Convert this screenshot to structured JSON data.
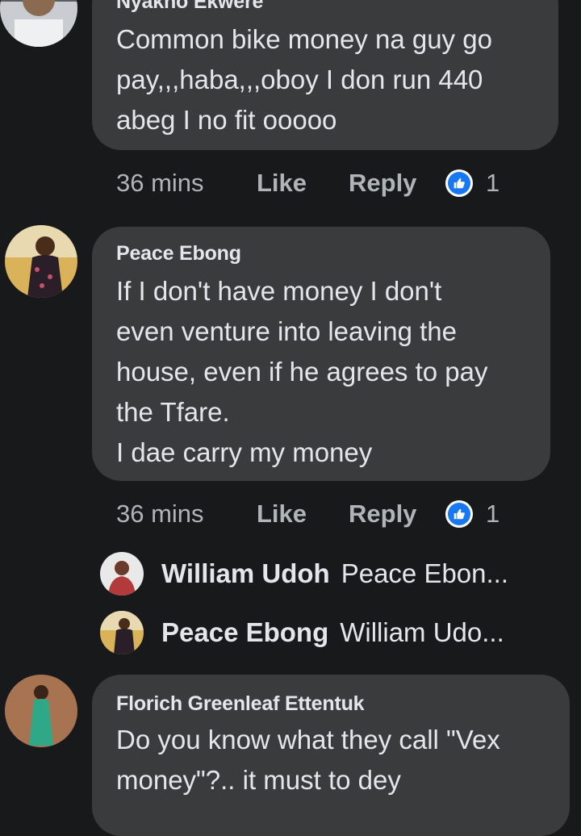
{
  "comments": [
    {
      "author": "Nyakno Ekwere",
      "text": "Common bike money na guy go\npay,,,haba,,,oboy I don run 440\nabeg I no fit ooooo",
      "time": "36 mins",
      "like_label": "Like",
      "reply_label": "Reply",
      "reaction_count": "1",
      "reaction_icon": "thumbs-up-icon"
    },
    {
      "author": "Peace Ebong",
      "text": "If I don't have money I don't\neven venture into leaving the\nhouse, even if he agrees to pay\nthe Tfare.\nI dae carry my money",
      "time": "36 mins",
      "like_label": "Like",
      "reply_label": "Reply",
      "reaction_count": "1",
      "reaction_icon": "thumbs-up-icon",
      "replies": [
        {
          "author": "William Udoh",
          "preview": "Peace Ebon..."
        },
        {
          "author": "Peace Ebong",
          "preview": "William Udo..."
        }
      ]
    },
    {
      "author": "Florich Greenleaf Ettentuk",
      "text": "Do you know what they call \"Vex\nmoney\"?.. it must to dey"
    }
  ],
  "colors": {
    "background": "#18191a",
    "bubble": "#3a3b3c",
    "text": "#e4e6eb",
    "secondary_text": "#b0b3b8",
    "reaction_blue": "#1877f2"
  }
}
